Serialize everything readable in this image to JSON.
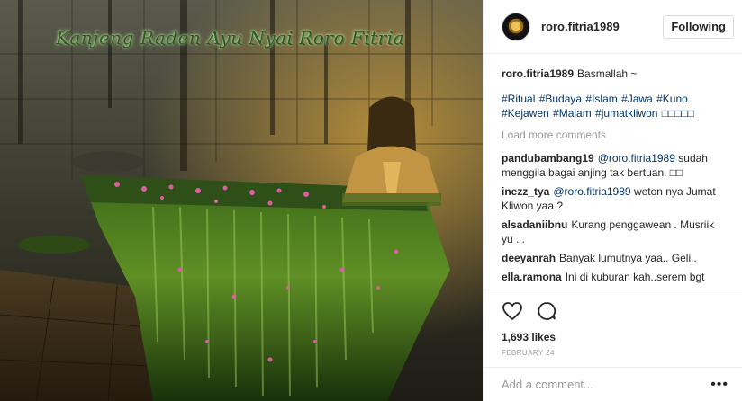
{
  "photo": {
    "overlay_text": "Kanjeng Raden Ayu Nyai Roro Fitria"
  },
  "header": {
    "username": "roro.fitria1989",
    "follow_label": "Following"
  },
  "caption": {
    "username": "roro.fitria1989",
    "text": "Basmallah ~",
    "hashtags": "#Ritual #Budaya #Islam #Jawa #Kuno #Kejawen #Malam #jumatkliwon □□□□□"
  },
  "load_more": "Load more comments",
  "comments": [
    {
      "username": "pandubambang19",
      "mention": "@roro.fitria1989",
      "text": "sudah menggila bagai anjing tak bertuan. □□"
    },
    {
      "username": "inezz_tya",
      "mention": "@roro.fitria1989",
      "text": "weton nya Jumat Kliwon yaa ?"
    },
    {
      "username": "alsadaniibnu",
      "mention": "",
      "text": "Kurang penggawean . Musriik yu . ."
    },
    {
      "username": "deeyanrah",
      "mention": "",
      "text": "Banyak lumutnya yaa.. Geli.."
    },
    {
      "username": "ella.ramona",
      "mention": "",
      "text": "Ini di kuburan kah..serem bgt"
    }
  ],
  "likes": "1,693 likes",
  "date": "FEBRUARY 24",
  "add_comment": {
    "placeholder": "Add a comment...",
    "more_label": "•••"
  },
  "icons": {
    "like": "heart-icon",
    "comment": "comment-bubble-icon",
    "options": "more-options-icon"
  }
}
